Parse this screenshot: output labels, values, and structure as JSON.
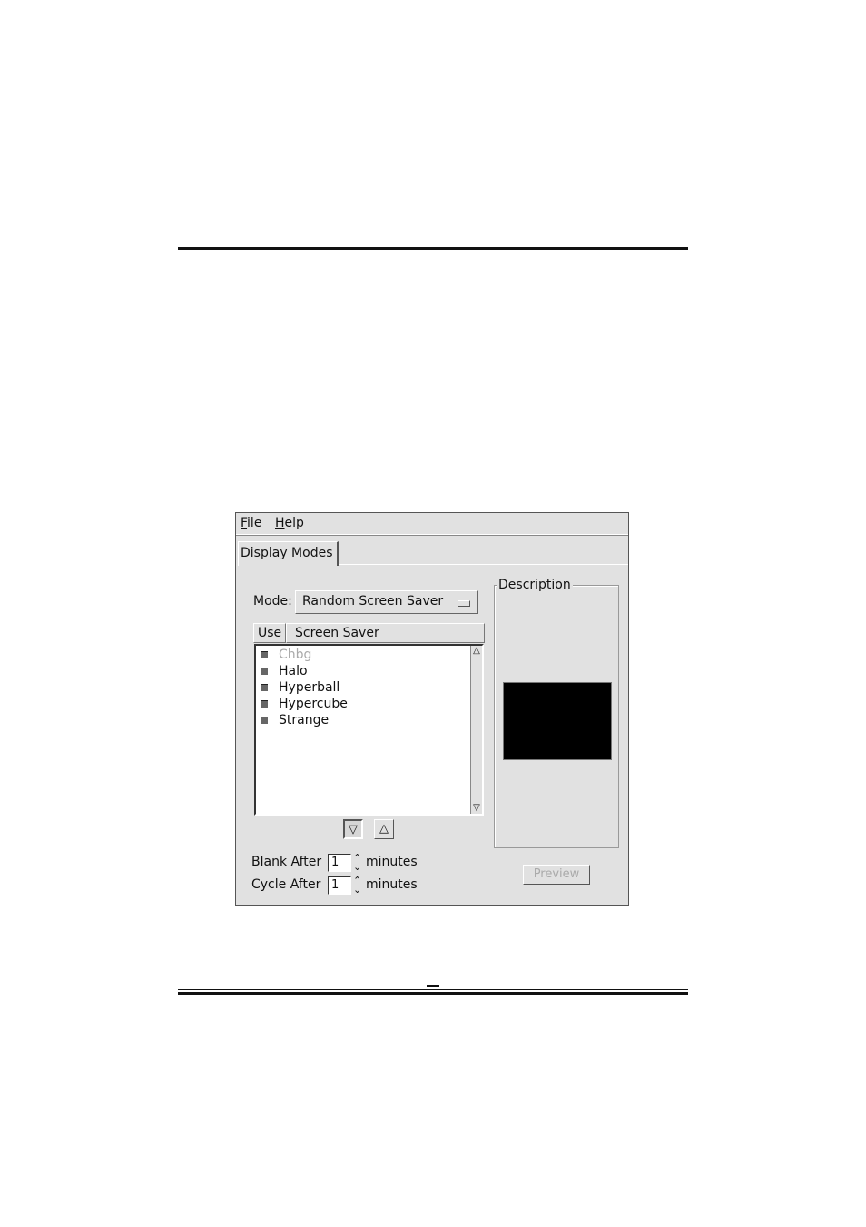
{
  "menu": {
    "file": "File",
    "help": "Help"
  },
  "tab": {
    "label": "Display Modes"
  },
  "mode": {
    "label": "Mode:",
    "value": "Random Screen Saver"
  },
  "list": {
    "headers": {
      "use": "Use",
      "screen_saver": "Screen Saver"
    },
    "items": [
      {
        "name": "Chbg",
        "checked": true,
        "dimmed": true
      },
      {
        "name": "Halo",
        "checked": true,
        "dimmed": false
      },
      {
        "name": "Hyperball",
        "checked": true,
        "dimmed": false
      },
      {
        "name": "Hypercube",
        "checked": true,
        "dimmed": false
      },
      {
        "name": "Strange",
        "checked": true,
        "dimmed": false
      }
    ]
  },
  "timing": {
    "blank": {
      "label": "Blank After",
      "value": "1",
      "unit": "minutes"
    },
    "cycle": {
      "label": "Cycle After",
      "value": "1",
      "unit": "minutes"
    }
  },
  "description": {
    "legend": "Description"
  },
  "preview": {
    "label": "Preview"
  }
}
